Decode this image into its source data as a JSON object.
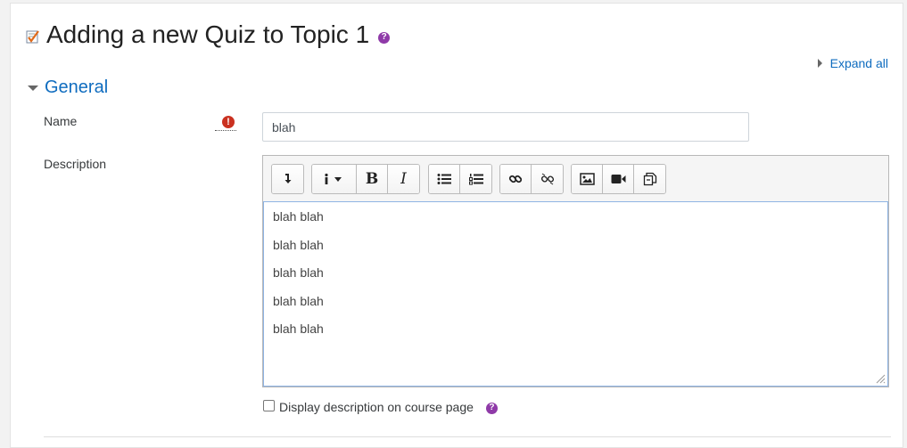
{
  "page": {
    "title": "Adding a new Quiz to Topic 1",
    "expand_all": "Expand all"
  },
  "section": {
    "title": "General"
  },
  "form": {
    "name_label": "Name",
    "name_value": "blah",
    "description_label": "Description",
    "description_lines": [
      "blah blah",
      "blah blah",
      "blah blah",
      "blah blah",
      "blah blah"
    ],
    "display_description_label": "Display description on course page"
  },
  "toolbar": {
    "groups": [
      [
        "collapse-icon"
      ],
      [
        "info-style-icon",
        "bold-icon",
        "italic-icon"
      ],
      [
        "unordered-list-icon",
        "ordered-list-icon"
      ],
      [
        "link-icon",
        "unlink-icon"
      ],
      [
        "image-icon",
        "video-icon",
        "manage-files-icon"
      ]
    ]
  },
  "colors": {
    "link": "#0f6cbf",
    "help": "#8f3aa8",
    "required": "#ca3120"
  }
}
